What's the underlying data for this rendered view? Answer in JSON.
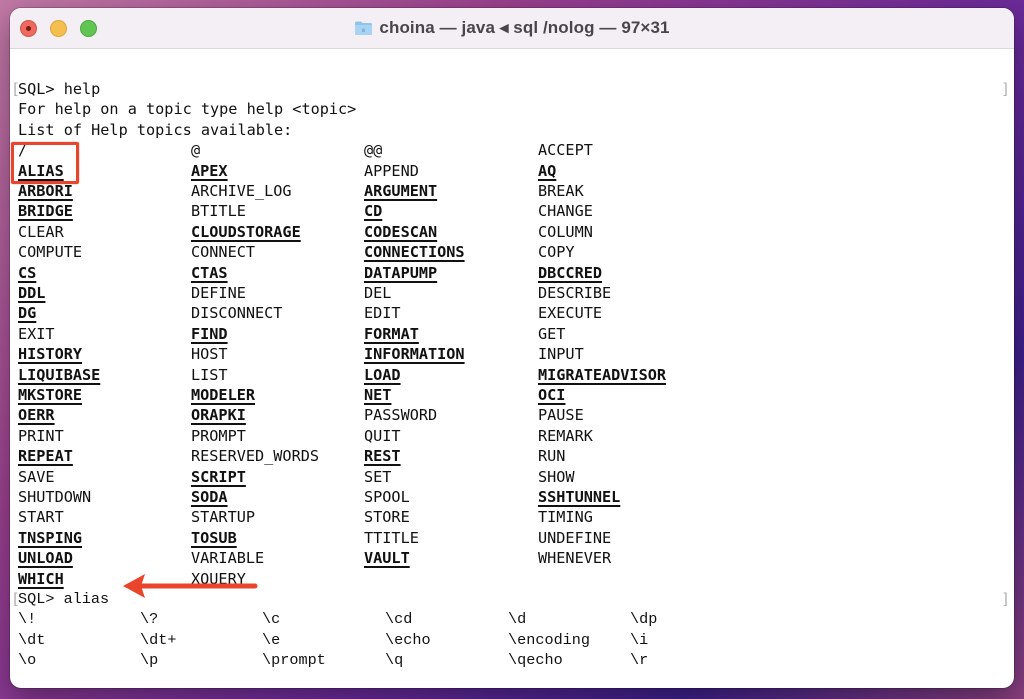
{
  "window": {
    "title": "choina — java ◂ sql /nolog — 97×31",
    "title_icon": "folder-icon",
    "controls": [
      "close",
      "minimize",
      "maximize"
    ]
  },
  "terminal": {
    "prompt1": "SQL> help",
    "help_line": "For help on a topic type help <topic>",
    "list_header": "List of Help topics available:",
    "topics": [
      [
        {
          "t": "/",
          "b": false
        },
        {
          "t": "@",
          "b": false
        },
        {
          "t": "@@",
          "b": false
        },
        {
          "t": "ACCEPT",
          "b": false
        }
      ],
      [
        {
          "t": "ALIAS",
          "b": true
        },
        {
          "t": "APEX",
          "b": true
        },
        {
          "t": "APPEND",
          "b": false
        },
        {
          "t": "AQ",
          "b": true
        }
      ],
      [
        {
          "t": "ARBORI",
          "b": true
        },
        {
          "t": "ARCHIVE_LOG",
          "b": false
        },
        {
          "t": "ARGUMENT",
          "b": true
        },
        {
          "t": "BREAK",
          "b": false
        }
      ],
      [
        {
          "t": "BRIDGE",
          "b": true
        },
        {
          "t": "BTITLE",
          "b": false
        },
        {
          "t": "CD",
          "b": true
        },
        {
          "t": "CHANGE",
          "b": false
        }
      ],
      [
        {
          "t": "CLEAR",
          "b": false
        },
        {
          "t": "CLOUDSTORAGE",
          "b": true
        },
        {
          "t": "CODESCAN",
          "b": true
        },
        {
          "t": "COLUMN",
          "b": false
        }
      ],
      [
        {
          "t": "COMPUTE",
          "b": false
        },
        {
          "t": "CONNECT",
          "b": false
        },
        {
          "t": "CONNECTIONS",
          "b": true
        },
        {
          "t": "COPY",
          "b": false
        }
      ],
      [
        {
          "t": "CS",
          "b": true
        },
        {
          "t": "CTAS",
          "b": true
        },
        {
          "t": "DATAPUMP",
          "b": true
        },
        {
          "t": "DBCCRED",
          "b": true
        }
      ],
      [
        {
          "t": "DDL",
          "b": true
        },
        {
          "t": "DEFINE",
          "b": false
        },
        {
          "t": "DEL",
          "b": false
        },
        {
          "t": "DESCRIBE",
          "b": false
        }
      ],
      [
        {
          "t": "DG",
          "b": true
        },
        {
          "t": "DISCONNECT",
          "b": false
        },
        {
          "t": "EDIT",
          "b": false
        },
        {
          "t": "EXECUTE",
          "b": false
        }
      ],
      [
        {
          "t": "EXIT",
          "b": false
        },
        {
          "t": "FIND",
          "b": true
        },
        {
          "t": "FORMAT",
          "b": true
        },
        {
          "t": "GET",
          "b": false
        }
      ],
      [
        {
          "t": "HISTORY",
          "b": true
        },
        {
          "t": "HOST",
          "b": false
        },
        {
          "t": "INFORMATION",
          "b": true
        },
        {
          "t": "INPUT",
          "b": false
        }
      ],
      [
        {
          "t": "LIQUIBASE",
          "b": true
        },
        {
          "t": "LIST",
          "b": false
        },
        {
          "t": "LOAD",
          "b": true
        },
        {
          "t": "MIGRATEADVISOR",
          "b": true
        }
      ],
      [
        {
          "t": "MKSTORE",
          "b": true
        },
        {
          "t": "MODELER",
          "b": true
        },
        {
          "t": "NET",
          "b": true
        },
        {
          "t": "OCI",
          "b": true
        }
      ],
      [
        {
          "t": "OERR",
          "b": true
        },
        {
          "t": "ORAPKI",
          "b": true
        },
        {
          "t": "PASSWORD",
          "b": false
        },
        {
          "t": "PAUSE",
          "b": false
        }
      ],
      [
        {
          "t": "PRINT",
          "b": false
        },
        {
          "t": "PROMPT",
          "b": false
        },
        {
          "t": "QUIT",
          "b": false
        },
        {
          "t": "REMARK",
          "b": false
        }
      ],
      [
        {
          "t": "REPEAT",
          "b": true
        },
        {
          "t": "RESERVED_WORDS",
          "b": false
        },
        {
          "t": "REST",
          "b": true
        },
        {
          "t": "RUN",
          "b": false
        }
      ],
      [
        {
          "t": "SAVE",
          "b": false
        },
        {
          "t": "SCRIPT",
          "b": true
        },
        {
          "t": "SET",
          "b": false
        },
        {
          "t": "SHOW",
          "b": false
        }
      ],
      [
        {
          "t": "SHUTDOWN",
          "b": false
        },
        {
          "t": "SODA",
          "b": true
        },
        {
          "t": "SPOOL",
          "b": false
        },
        {
          "t": "SSHTUNNEL",
          "b": true
        }
      ],
      [
        {
          "t": "START",
          "b": false
        },
        {
          "t": "STARTUP",
          "b": false
        },
        {
          "t": "STORE",
          "b": false
        },
        {
          "t": "TIMING",
          "b": false
        }
      ],
      [
        {
          "t": "TNSPING",
          "b": true
        },
        {
          "t": "TOSUB",
          "b": true
        },
        {
          "t": "TTITLE",
          "b": false
        },
        {
          "t": "UNDEFINE",
          "b": false
        }
      ],
      [
        {
          "t": "UNLOAD",
          "b": true
        },
        {
          "t": "VARIABLE",
          "b": false
        },
        {
          "t": "VAULT",
          "b": true
        },
        {
          "t": "WHENEVER",
          "b": false
        }
      ],
      [
        {
          "t": "WHICH",
          "b": true
        },
        {
          "t": "XQUERY",
          "b": false
        }
      ]
    ],
    "prompt2": "SQL> alias",
    "aliases": [
      [
        "\\!",
        "\\?",
        "\\c",
        "\\cd",
        "\\d",
        "\\dp"
      ],
      [
        "\\dt",
        "\\dt+",
        "\\e",
        "\\echo",
        "\\encoding",
        "\\i"
      ],
      [
        "\\o",
        "\\p",
        "\\prompt",
        "\\q",
        "\\qecho",
        "\\r"
      ]
    ]
  },
  "annotations": {
    "highlight_target": "ALIAS",
    "arrow_target": "SQL> alias",
    "color": "#e8452c"
  }
}
